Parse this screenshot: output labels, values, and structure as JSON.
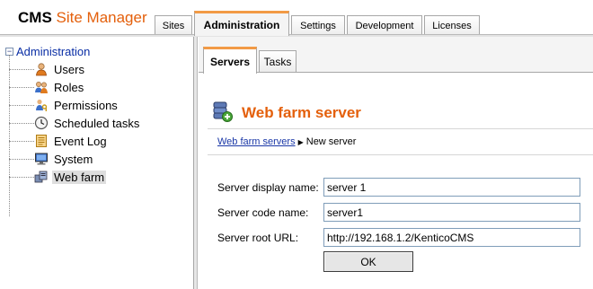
{
  "app": {
    "logo_cms": "CMS",
    "logo_site_manager": "Site Manager",
    "accent_color": "#e4600c"
  },
  "top_tabs": [
    {
      "label": "Sites",
      "active": false
    },
    {
      "label": "Administration",
      "active": true
    },
    {
      "label": "Settings",
      "active": false
    },
    {
      "label": "Development",
      "active": false
    },
    {
      "label": "Licenses",
      "active": false
    }
  ],
  "tree": {
    "root_label": "Administration",
    "expander": "−",
    "items": [
      {
        "label": "Users",
        "icon": "user-icon"
      },
      {
        "label": "Roles",
        "icon": "roles-icon"
      },
      {
        "label": "Permissions",
        "icon": "permissions-icon"
      },
      {
        "label": "Scheduled tasks",
        "icon": "clock-icon"
      },
      {
        "label": "Event Log",
        "icon": "event-log-icon"
      },
      {
        "label": "System",
        "icon": "computer-icon"
      },
      {
        "label": "Web farm",
        "icon": "web-farm-icon",
        "selected": true
      }
    ]
  },
  "sub_tabs": [
    {
      "label": "Servers",
      "active": true
    },
    {
      "label": "Tasks",
      "active": false
    }
  ],
  "page": {
    "title": "Web farm server",
    "icon": "web-farm-server-icon"
  },
  "breadcrumb": {
    "link": "Web farm servers",
    "current": "New server"
  },
  "form": {
    "display_name_label": "Server display name:",
    "display_name_value": "server 1",
    "code_name_label": "Server code name:",
    "code_name_value": "server1",
    "root_url_label": "Server root URL:",
    "root_url_value": "http://192.168.1.2/KenticoCMS",
    "ok_label": "OK"
  }
}
